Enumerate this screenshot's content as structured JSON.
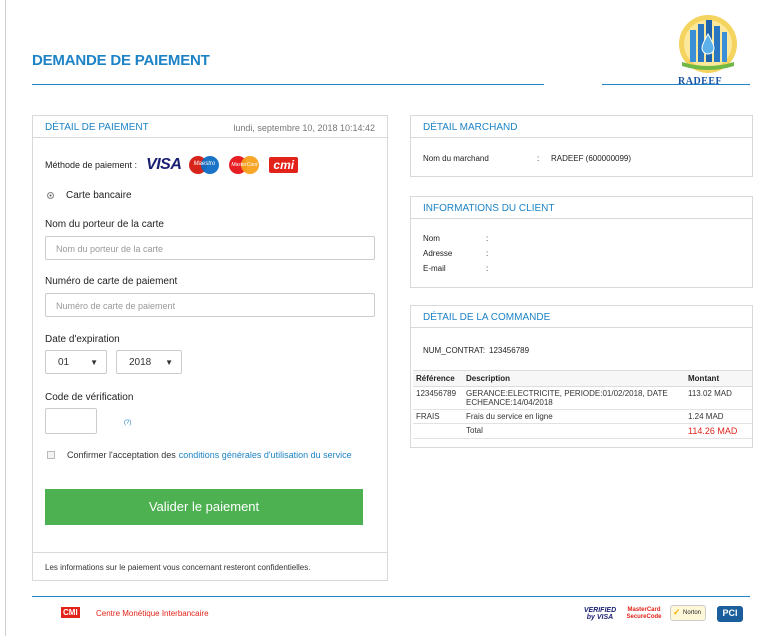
{
  "page": {
    "title": "DEMANDE DE PAIEMENT"
  },
  "logo": {
    "brand": "RADEEF"
  },
  "payment": {
    "header": "DÉTAIL DE PAIEMENT",
    "datetime": "lundi, septembre 10, 2018 10:14:42",
    "method_label": "Méthode de paiement :",
    "card_brands": [
      "VISA",
      "Maestro",
      "MasterCard",
      "cmi"
    ],
    "method_option": "Carte bancaire",
    "cardholder_label": "Nom du porteur de la carte",
    "cardholder_placeholder": "Nom du porteur de la carte",
    "cardnumber_label": "Numéro de carte de paiement",
    "cardnumber_placeholder": "Numéro de carte de paiement",
    "expiry_label": "Date d'expiration",
    "expiry_month": "01",
    "expiry_year": "2018",
    "cvv_label": "Code de vérification",
    "cvv_help": "(?)",
    "terms_prefix": "Confirmer l'acceptation des",
    "terms_link": "conditions générales d'utilisation du service",
    "submit_label": "Valider le paiement",
    "confidential_note": "Les informations sur le paiement vous concernant resteront confidentielles."
  },
  "merchant": {
    "header": "DÉTAIL MARCHAND",
    "name_label": "Nom du marchand",
    "name_value": "RADEEF (600000099)"
  },
  "client": {
    "header": "INFORMATIONS DU CLIENT",
    "nom_label": "Nom",
    "adresse_label": "Adresse",
    "email_label": "E-mail",
    "colon": ":"
  },
  "order": {
    "header": "DÉTAIL DE LA COMMANDE",
    "contract_label": "NUM_CONTRAT:",
    "contract_value": "123456789",
    "columns": [
      "Référence",
      "Description",
      "Montant"
    ],
    "rows": [
      {
        "ref": "123456789",
        "desc": "GERANCE:ELECTRICITE, PERIODE:01/02/2018, DATE ECHEANCE:14/04/2018",
        "amount": "113.02 MAD"
      },
      {
        "ref": "FRAIS",
        "desc": "Frais du service en ligne",
        "amount": "1.24 MAD"
      }
    ],
    "total_label": "Total",
    "total_value": "114.26 MAD"
  },
  "footer": {
    "cmi_logo": "CMI",
    "cmi_text": "Centre Monétique Interbancaire",
    "badges": {
      "vbv": "VERIFIED by VISA",
      "mcsc": "MasterCard SecureCode",
      "norton": "Norton",
      "pci": "PCI"
    }
  },
  "colors": {
    "accent": "#1d83c6",
    "button": "#4db152",
    "highlight": "#e2231a"
  }
}
